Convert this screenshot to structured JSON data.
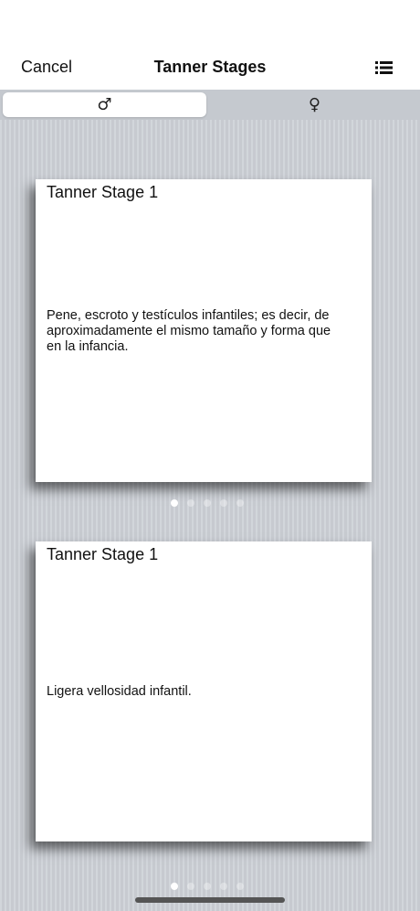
{
  "navbar": {
    "cancel_label": "Cancel",
    "title": "Tanner Stages",
    "list_icon": "list-icon"
  },
  "segment": {
    "male_symbol": "♂",
    "female_symbol": "♀",
    "selected": "male"
  },
  "cards": [
    {
      "title": "Tanner Stage 1",
      "text": "Pene, escroto y testículos infantiles; es decir, de aproximadamente el mismo tamaño y forma que en la infancia.",
      "page_index": 1,
      "page_count": 5
    },
    {
      "title": "Tanner Stage 1",
      "text": "Ligera vellosidad infantil.",
      "page_index": 1,
      "page_count": 5
    }
  ],
  "colors": {
    "background": "#cdd1d7",
    "segment_bg": "#c5c9cf",
    "card": "#ffffff",
    "text": "#111111"
  }
}
